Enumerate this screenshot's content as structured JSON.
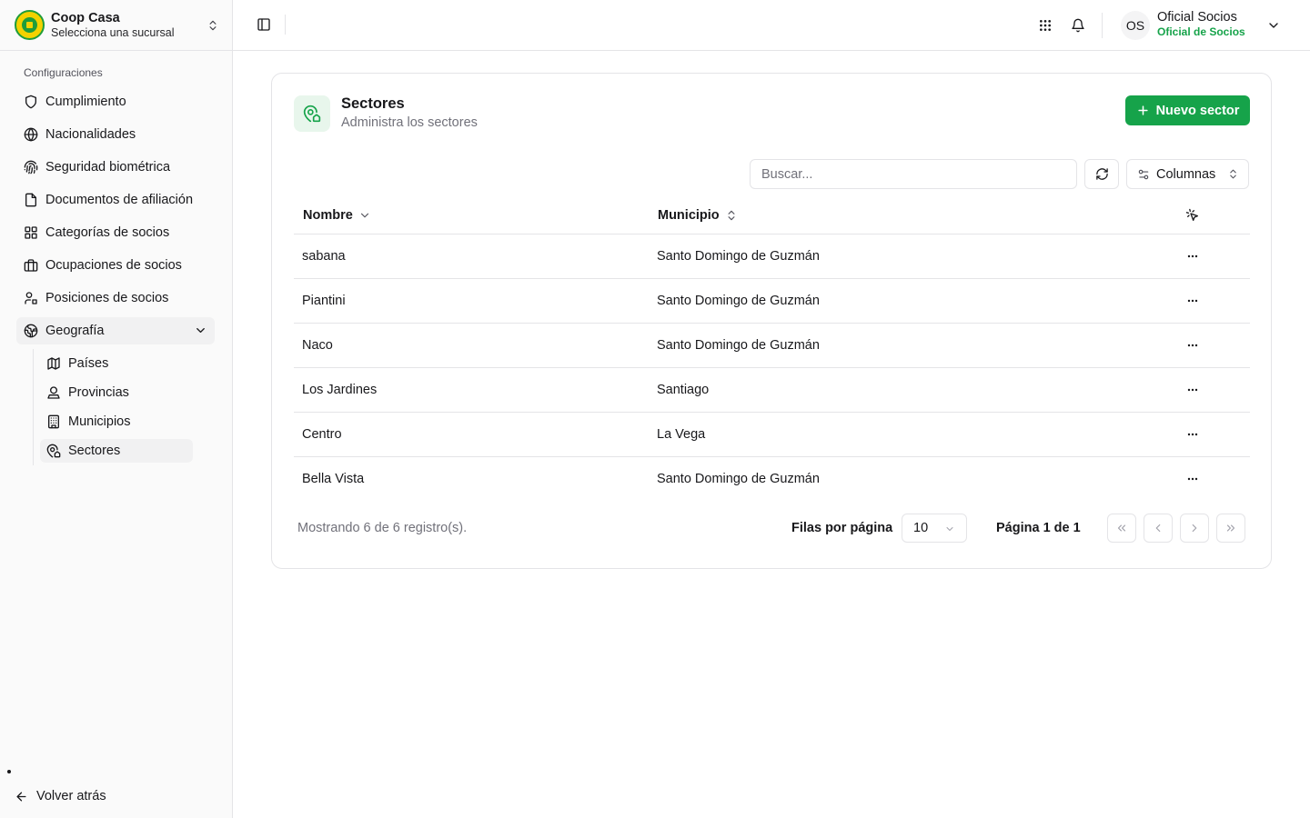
{
  "brand": {
    "name": "Coop Casa",
    "subtitle": "Selecciona una sucursal"
  },
  "sidebar": {
    "section_label": "Configuraciones",
    "items": [
      {
        "label": "Cumplimiento",
        "icon": "shield-icon"
      },
      {
        "label": "Nacionalidades",
        "icon": "globe-icon"
      },
      {
        "label": "Seguridad biométrica",
        "icon": "fingerprint-icon"
      },
      {
        "label": "Documentos de afiliación",
        "icon": "document-icon"
      },
      {
        "label": "Categorías de socios",
        "icon": "grid-icon"
      },
      {
        "label": "Ocupaciones de socios",
        "icon": "briefcase-icon"
      },
      {
        "label": "Posiciones de socios",
        "icon": "users-icon"
      },
      {
        "label": "Geografía",
        "icon": "earth-icon",
        "expanded": true
      }
    ],
    "sub_items": [
      {
        "label": "Países",
        "icon": "map-icon"
      },
      {
        "label": "Provincias",
        "icon": "user-pin-icon"
      },
      {
        "label": "Municipios",
        "icon": "building-icon"
      },
      {
        "label": "Sectores",
        "icon": "map-pin-house-icon",
        "active": true
      }
    ],
    "back_label": "Volver atrás"
  },
  "topbar": {
    "avatar_initials": "OS",
    "user_name": "Oficial Socios",
    "user_role": "Oficial de Socios"
  },
  "page": {
    "title": "Sectores",
    "subtitle": "Administra los sectores",
    "new_button": "Nuevo sector",
    "search_placeholder": "Buscar...",
    "columns_button": "Columnas",
    "accent_color": "#16a34a"
  },
  "table": {
    "headers": {
      "nombre": "Nombre",
      "municipio": "Municipio"
    },
    "rows": [
      {
        "nombre": "sabana",
        "municipio": "Santo Domingo de Guzmán"
      },
      {
        "nombre": "Piantini",
        "municipio": "Santo Domingo de Guzmán"
      },
      {
        "nombre": "Naco",
        "municipio": "Santo Domingo de Guzmán"
      },
      {
        "nombre": "Los Jardines",
        "municipio": "Santiago"
      },
      {
        "nombre": "Centro",
        "municipio": "La Vega"
      },
      {
        "nombre": "Bella Vista",
        "municipio": "Santo Domingo de Guzmán"
      }
    ]
  },
  "pagination": {
    "showing": "Mostrando 6 de 6 registro(s).",
    "rows_per_page_label": "Filas por página",
    "rows_per_page": "10",
    "page_label": "Página 1 de 1"
  }
}
